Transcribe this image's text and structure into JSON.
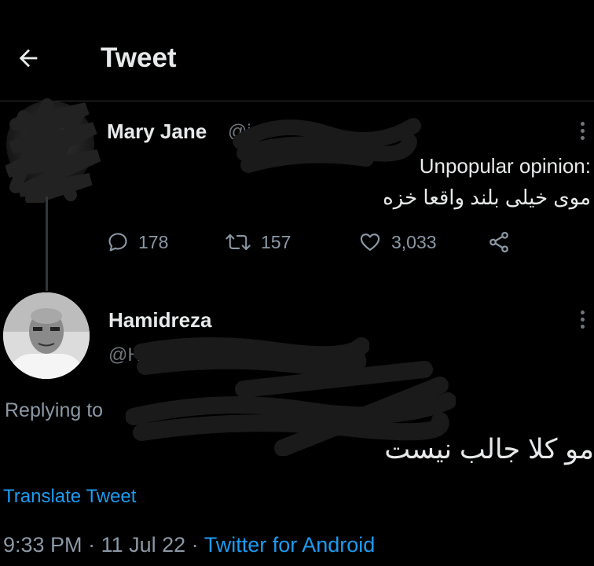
{
  "header": {
    "title": "Tweet"
  },
  "parent_tweet": {
    "author_name": "Mary Jane",
    "author_handle": "@i",
    "text_lines": [
      ":Unpopular opinion",
      "موی خیلی بلند واقعا خزه"
    ],
    "replies": "178",
    "retweets": "157",
    "likes": "3,033"
  },
  "reply_tweet": {
    "author_name": "Hamidreza",
    "author_handle": "@H",
    "replying_to_label": "Replying to",
    "text": "مو کلا جالب نیست",
    "translate_label": "Translate Tweet",
    "time": "9:33 PM",
    "date": "11 Jul 22",
    "source": "Twitter for Android"
  },
  "colors": {
    "background": "#000000",
    "text_primary": "#e7e9ea",
    "text_secondary": "#8b98a5",
    "link": "#1d9bf0",
    "divider": "#2f3336"
  },
  "icons": {
    "back": "arrow-left-icon",
    "reply": "speech-bubble-icon",
    "retweet": "retweet-icon",
    "like": "heart-icon",
    "share": "share-icon",
    "more": "more-vertical-icon"
  }
}
